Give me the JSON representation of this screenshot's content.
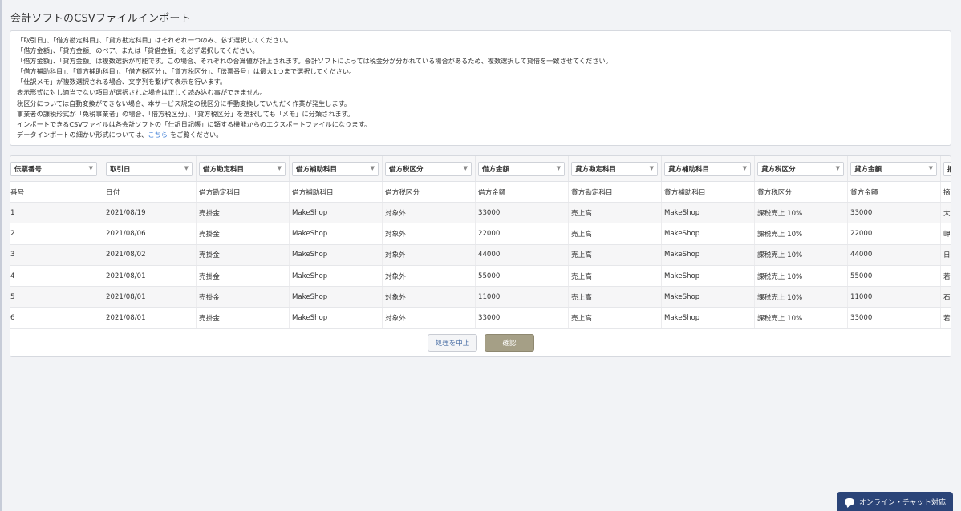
{
  "page": {
    "title": "会計ソフトのCSVファイルインポート"
  },
  "notice": {
    "lines": [
      "「取引日」、「借方勘定科目」、「貸方勘定科目」はそれぞれ一つのみ、必ず選択してください。",
      "「借方金額」、「貸方金額」のペア、または「貸借金額」を必ず選択してください。",
      "「借方金額」、「貸方金額」は複数選択が可能です。この場合、それぞれの合算値が計上されます。会計ソフトによっては税金分が分かれている場合があるため、複数選択して貸借を一致させてください。",
      "「借方補助科目」、「貸方補助科目」、「借方税区分」、「貸方税区分」、「伝票番号」は最大1つまで選択してください。",
      "「仕訳メモ」が複数選択される場合、文字列を繋げて表示を行います。",
      "表示形式に対し適当でない項目が選択された場合は正しく読み込む事ができません。",
      "税区分については自動変換ができない場合、本サービス規定の税区分に手動変換していただく作業が発生します。",
      "事業者の課税形式が「免税事業者」の場合、「借方税区分」、「貸方税区分」を選択しても「メモ」に分類されます。",
      "インポートできるCSVファイルは各会計ソフトの「仕訳日記帳」に類する機能からのエクスポートファイルになります。"
    ],
    "last_line_prefix": "データインポートの細かい形式については、",
    "last_line_link": "こちら",
    "last_line_suffix": "をご覧ください。"
  },
  "table": {
    "column_selects": [
      "伝票番号",
      "取引日",
      "借方勘定科目",
      "借方補助科目",
      "借方税区分",
      "借方金額",
      "貸方勘定科目",
      "貸方補助科目",
      "貸方税区分",
      "貸方金額",
      "摘"
    ],
    "headers": [
      "番号",
      "日付",
      "借方勘定科目",
      "借方補助科目",
      "借方税区分",
      "借方金額",
      "貸方勘定科目",
      "貸方補助科目",
      "貸方税区分",
      "貸方金額",
      "摘要"
    ],
    "rows": [
      [
        "1",
        "2021/08/19",
        "売掛金",
        "MakeShop",
        "対象外",
        "33000",
        "売上高",
        "MakeShop",
        "課税売上 10%",
        "33000",
        "大"
      ],
      [
        "2",
        "2021/08/06",
        "売掛金",
        "MakeShop",
        "対象外",
        "22000",
        "売上高",
        "MakeShop",
        "課税売上 10%",
        "22000",
        "岬"
      ],
      [
        "3",
        "2021/08/02",
        "売掛金",
        "MakeShop",
        "対象外",
        "44000",
        "売上高",
        "MakeShop",
        "課税売上 10%",
        "44000",
        "日"
      ],
      [
        "4",
        "2021/08/01",
        "売掛金",
        "MakeShop",
        "対象外",
        "55000",
        "売上高",
        "MakeShop",
        "課税売上 10%",
        "55000",
        "若"
      ],
      [
        "5",
        "2021/08/01",
        "売掛金",
        "MakeShop",
        "対象外",
        "11000",
        "売上高",
        "MakeShop",
        "課税売上 10%",
        "11000",
        "石"
      ],
      [
        "6",
        "2021/08/01",
        "売掛金",
        "MakeShop",
        "対象外",
        "33000",
        "売上高",
        "MakeShop",
        "課税売上 10%",
        "33000",
        "若"
      ]
    ]
  },
  "buttons": {
    "cancel": "処理を中止",
    "confirm": "確認"
  },
  "chat": {
    "label": "オンライン・チャット対応"
  },
  "icons": {
    "dropdown": "chevron-down-icon",
    "chat": "chat-bubble-icon"
  }
}
